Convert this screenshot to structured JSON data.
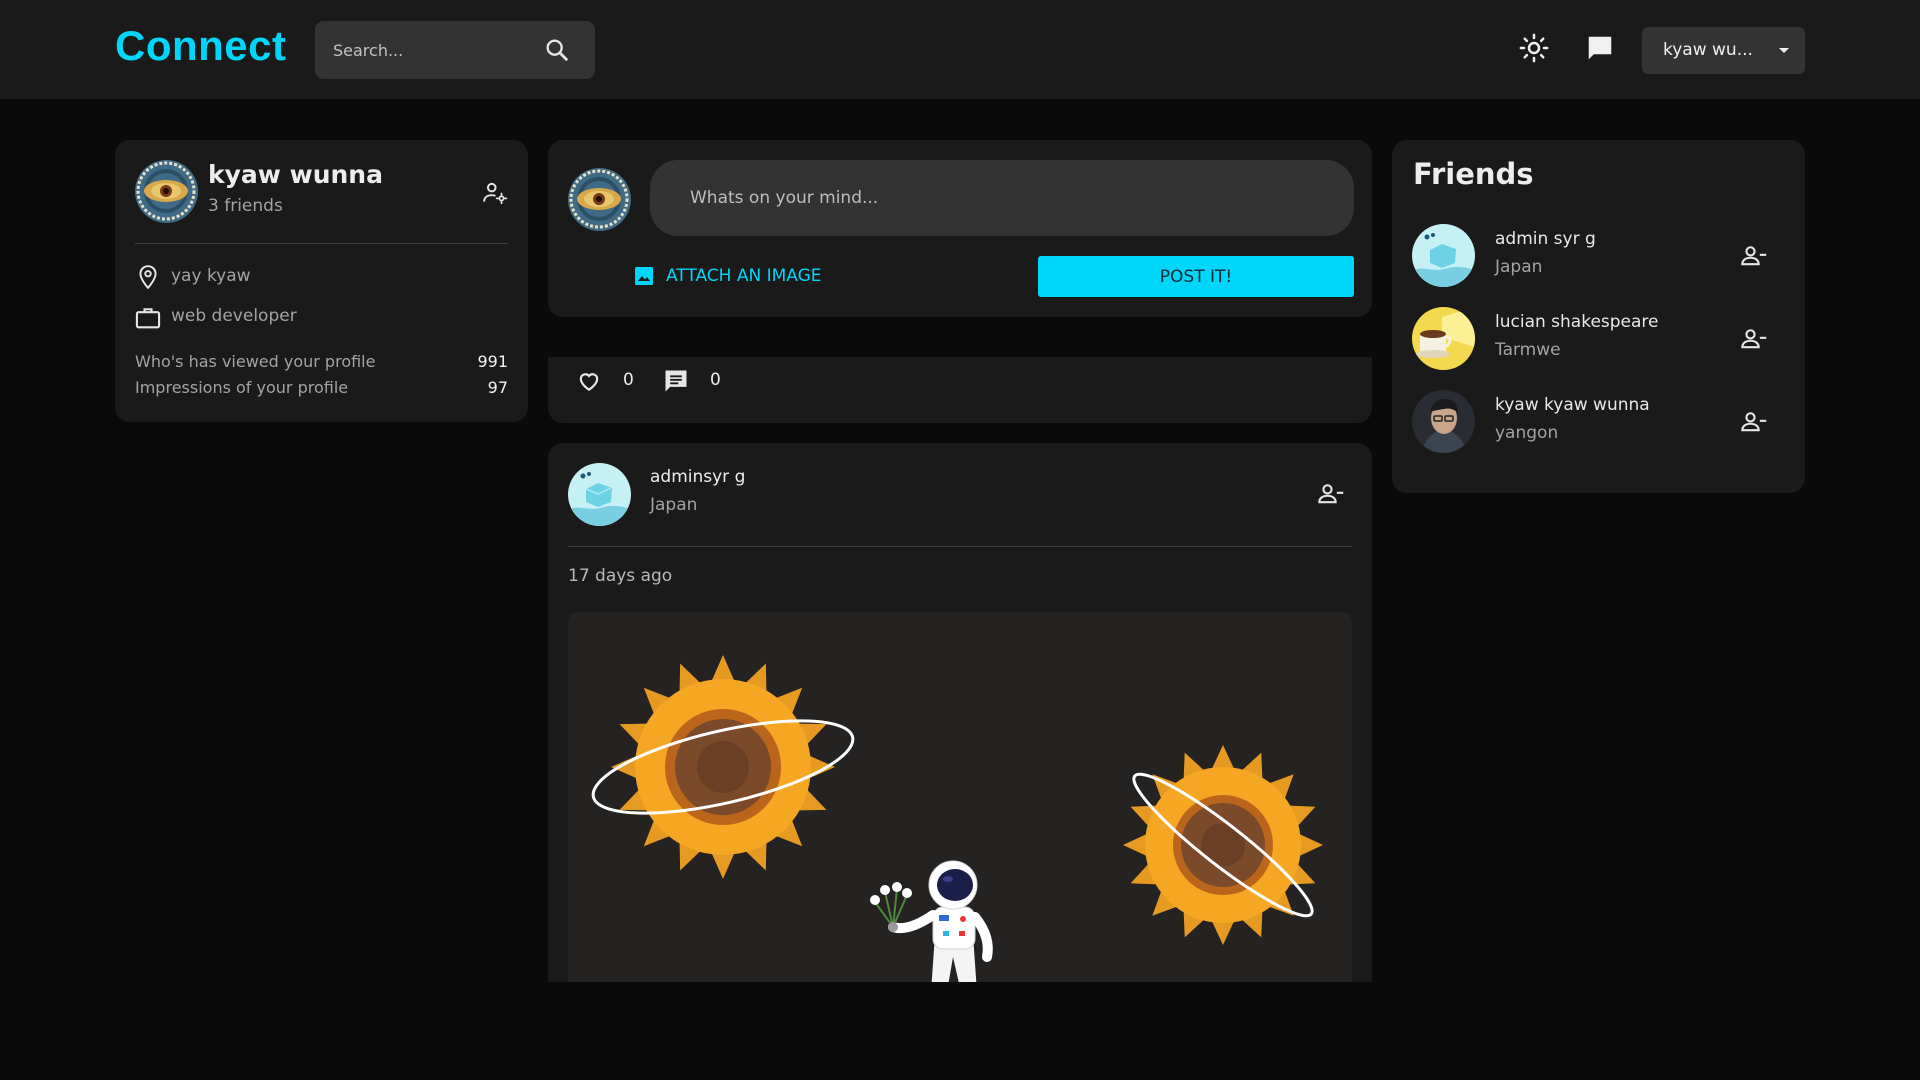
{
  "app": {
    "logo": "Connect",
    "accent": "#00d5fa"
  },
  "header": {
    "search_placeholder": "Search...",
    "user_select_value": "kyaw wu..."
  },
  "profile": {
    "name": "kyaw wunna",
    "friends_count": "3 friends",
    "location": "yay kyaw",
    "occupation": "web developer",
    "stats": [
      {
        "label": "Who's has viewed your profile",
        "value": "991"
      },
      {
        "label": "Impressions of your profile",
        "value": "97"
      }
    ]
  },
  "composer": {
    "placeholder": "Whats on your mind...",
    "attach_label": "ATTACH AN IMAGE",
    "post_label": "POST IT!"
  },
  "previous_post": {
    "likes": "0",
    "comments": "0"
  },
  "post": {
    "author": "adminsyr g",
    "location": "Japan",
    "time": "17 days ago"
  },
  "friends": {
    "title": "Friends",
    "items": [
      {
        "name": "admin syr g",
        "location": "Japan"
      },
      {
        "name": "lucian shakespeare",
        "location": "Tarmwe"
      },
      {
        "name": "kyaw kyaw wunna",
        "location": "yangon"
      }
    ]
  }
}
